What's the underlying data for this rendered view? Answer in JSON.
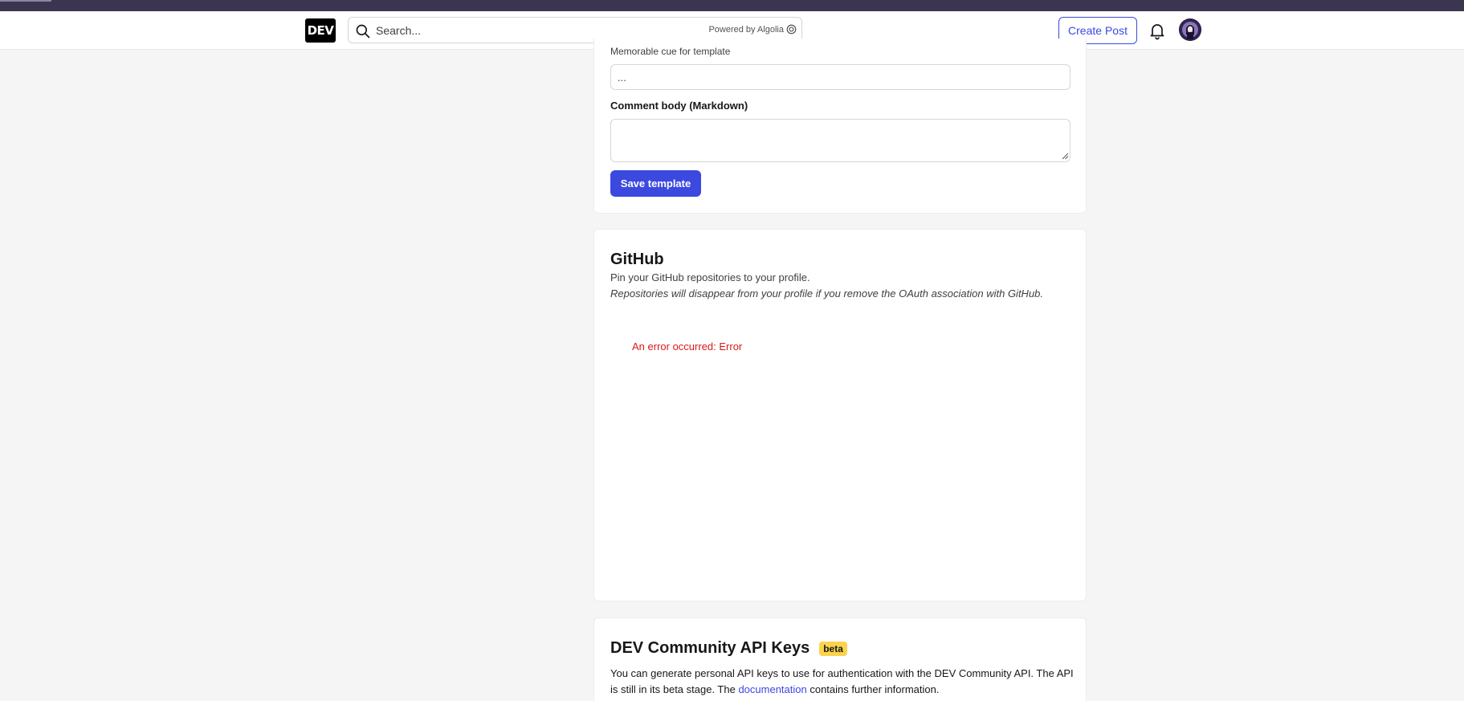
{
  "header": {
    "logo_text": "DEV",
    "search_placeholder": "Search...",
    "algolia_text": "Powered by Algolia",
    "create_post_label": "Create Post"
  },
  "template_form": {
    "cue_label": "Memorable cue for template",
    "cue_value": "...",
    "body_label": "Comment body (Markdown)",
    "body_value": "",
    "save_label": "Save template"
  },
  "github": {
    "title": "GitHub",
    "description": "Pin your GitHub repositories to your profile.",
    "note": "Repositories will disappear from your profile if you remove the OAuth association with GitHub.",
    "error": "An error occurred: Error"
  },
  "api_keys": {
    "title": "DEV Community API Keys",
    "badge": "beta",
    "desc_before": "You can generate personal API keys to use for authentication with the DEV Community API. The API is still in its beta stage. The ",
    "link_text": "documentation",
    "desc_after": " contains further information."
  },
  "colors": {
    "accent": "#3b49df",
    "error": "#dc1818",
    "badge": "#fcd34d",
    "page_bg": "#f5f5f5"
  }
}
